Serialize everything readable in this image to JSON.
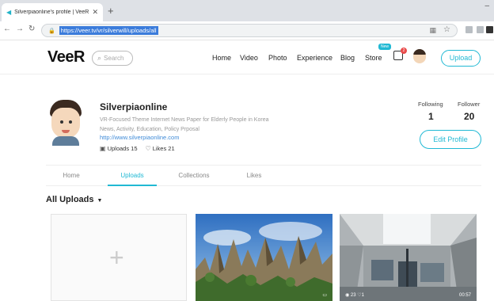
{
  "browser": {
    "tab_title": "Silverpiaonline's profile | VeeR",
    "tab_close": "✕",
    "new_tab": "+",
    "url": "https://veer.tv/vr/silverwill/uploads/all"
  },
  "header": {
    "logo": "VeeR",
    "search_placeholder": "Search",
    "nav": [
      "Home",
      "Video",
      "Photo",
      "Experience",
      "Blog",
      "Store"
    ],
    "store_badge": "New",
    "notification_count": "2",
    "upload_label": "Upload",
    "accent": "#21b9d4"
  },
  "profile": {
    "name": "Silverpiaonline",
    "bio_line1": "VR-Focused Theme Internet News Paper for Elderly People in Korea",
    "bio_line2": "News, Activity, Education, Policy Prposal",
    "website": "http://www.silverpiaonline.com",
    "uploads": "Uploads 15",
    "likes": "Likes 21",
    "following_label": "Following",
    "following_count": "1",
    "follower_label": "Follower",
    "follower_count": "20",
    "edit_label": "Edit Profile"
  },
  "tabs": [
    "Home",
    "Uploads",
    "Collections",
    "Likes"
  ],
  "active_tab": "Uploads",
  "section": {
    "title": "All Uploads",
    "caret": "▼"
  },
  "cards": [
    {
      "kind": "add",
      "plus": "+"
    },
    {
      "kind": "photo",
      "views": "",
      "right": ""
    },
    {
      "kind": "video",
      "views": "23",
      "likes": "1",
      "duration": "00:57"
    }
  ]
}
